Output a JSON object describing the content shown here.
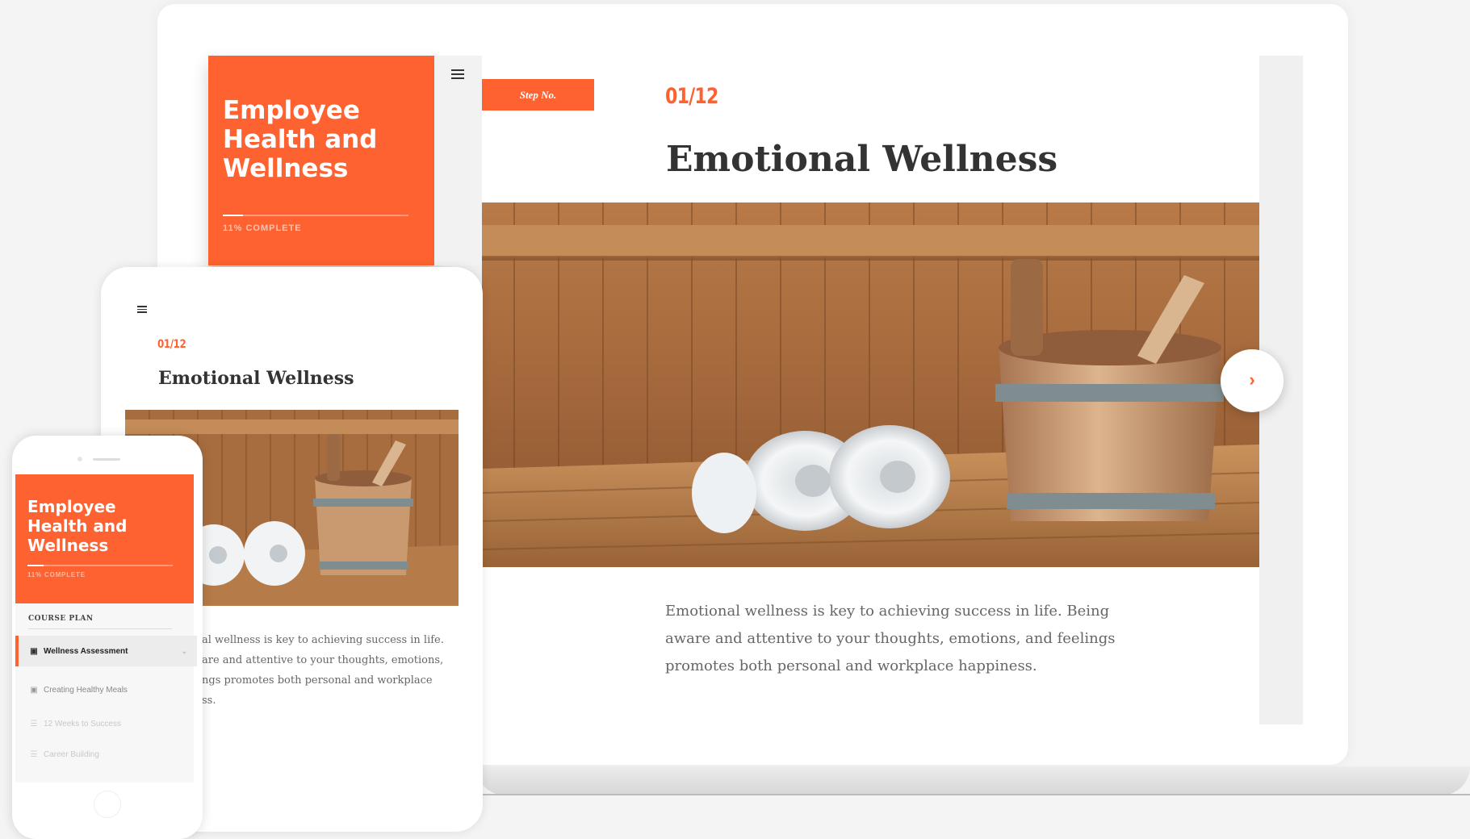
{
  "course": {
    "title": "Employee Health and Wellness",
    "progress_label": "11% COMPLETE",
    "progress_fraction": 0.11
  },
  "step": {
    "chip_label": "Step No.",
    "counter": "01/12",
    "title": "Emotional Wellness",
    "body": "Emotional wellness is key to achieving success in life. Being aware and attentive to your thoughts, emotions, and feelings promotes both personal and workplace happiness."
  },
  "tablet": {
    "counter": "01/12",
    "title": "Emotional Wellness",
    "body_visible": "al wellness is key to achieving success in life.\nare and attentive to your thoughts, emotions,\nngs promotes both personal and workplace\nss."
  },
  "phone": {
    "course_title": "Employee Health and Wellness",
    "progress_label": "11% COMPLETE",
    "plan_label": "COURSE PLAN",
    "items": [
      {
        "label": "Wellness Assessment",
        "icon": "video-icon",
        "state": "active"
      },
      {
        "label": "Creating Healthy Meals",
        "icon": "video-icon",
        "state": "done"
      },
      {
        "label": "12 Weeks to Success",
        "icon": "list-icon",
        "state": "locked"
      },
      {
        "label": "Career Building",
        "icon": "list-icon",
        "state": "locked"
      }
    ]
  },
  "nav": {
    "next_icon": "chevron-right-icon"
  },
  "colors": {
    "accent": "#fe6230",
    "heading": "#333333",
    "body_text": "#666666"
  }
}
